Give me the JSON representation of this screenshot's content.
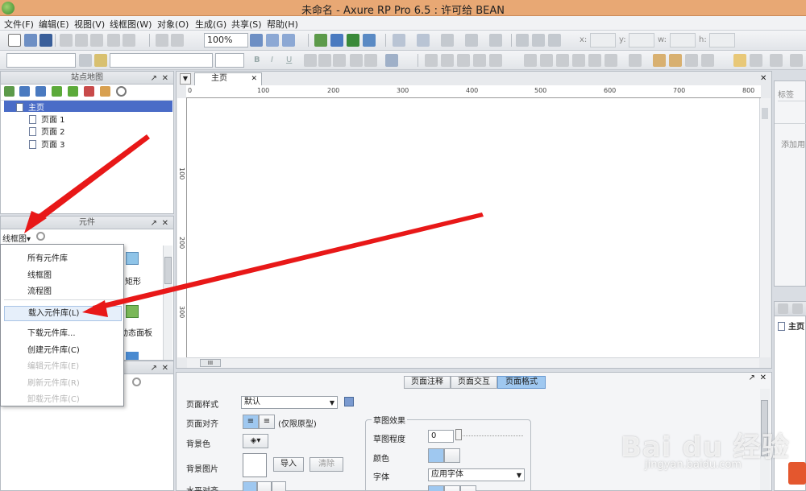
{
  "window": {
    "title": "未命名 - Axure RP Pro 6.5 : 许可给 BEAN"
  },
  "menu": [
    "文件(F)",
    "编辑(E)",
    "视图(V)",
    "线框图(W)",
    "对象(O)",
    "生成(G)",
    "共享(S)",
    "帮助(H)"
  ],
  "toolbar": {
    "zoom": "100%",
    "x_label": "x:",
    "y_label": "y:",
    "w_label": "w:",
    "h_label": "h:",
    "bold": "B",
    "italic": "I",
    "underline": "U"
  },
  "sitemap": {
    "title": "站点地图",
    "items": [
      "主页",
      "页面 1",
      "页面 2",
      "页面 3"
    ]
  },
  "widgets": {
    "title": "元件",
    "library_select": "线框图",
    "peek_labels": [
      "矩形",
      "动态面板"
    ],
    "dropdown": [
      "所有元件库",
      "线框图",
      "流程图",
      "载入元件库(L)",
      "下载元件库...",
      "创建元件库(C)",
      "编辑元件库(E)",
      "刷新元件库(R)",
      "卸载元件库(C)"
    ]
  },
  "editor": {
    "tab": "主页",
    "ruler_h": [
      "0",
      "100",
      "200",
      "300",
      "400",
      "500",
      "600",
      "700",
      "800"
    ],
    "ruler_v": [
      "100",
      "200",
      "300"
    ],
    "hscroll_grip": "III"
  },
  "page_props": {
    "tabs": [
      "页面注释",
      "页面交互",
      "页面格式"
    ],
    "page_style_label": "页面样式",
    "page_style_value": "默认",
    "align_label": "页面对齐",
    "align_note": "(仅限原型)",
    "bg_color_label": "背景色",
    "bg_image_label": "背景图片",
    "import_button": "导入",
    "clear_button": "清除",
    "h_align_label": "水平对齐",
    "sketch_group": "草图效果",
    "sketch_level_label": "草图程度",
    "sketch_level_value": "0",
    "color_label": "颜色",
    "font_label": "字体",
    "font_value": "应用字体"
  },
  "right_panel": {
    "label_title": "标签",
    "add_placeholder": "添加用",
    "page_item": "主页"
  },
  "watermark": {
    "brand": "Bai du 经验",
    "url": "jingyan.baidu.com"
  },
  "colors": {
    "titlebar": "#e8a874",
    "selection": "#4a6cc7",
    "active_tab": "#9fc8f0",
    "annotation_arrow": "#e81818"
  }
}
